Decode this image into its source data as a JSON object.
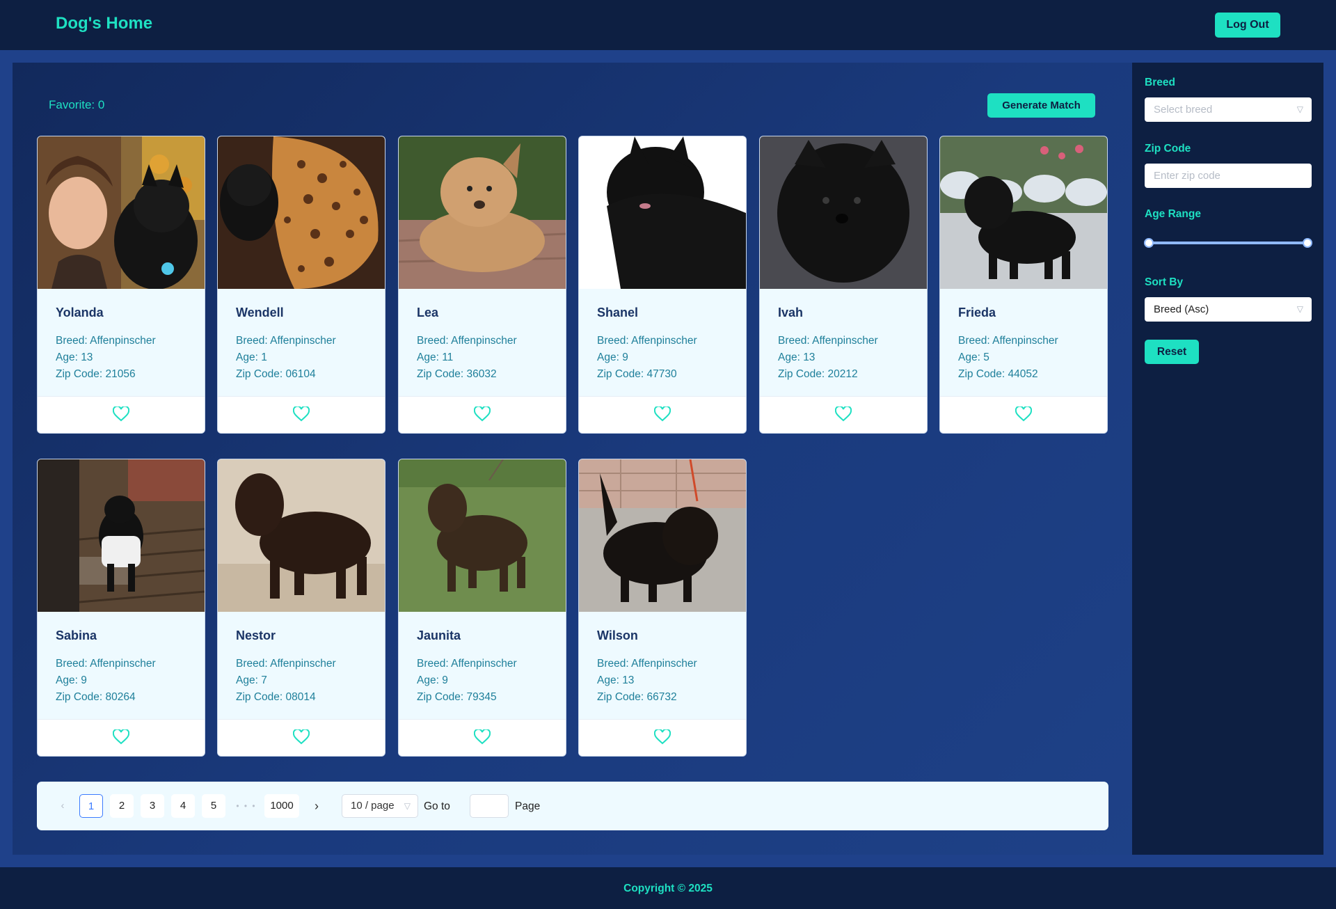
{
  "header": {
    "logo": "Dog's Home",
    "logout_label": "Log Out"
  },
  "toolbar": {
    "favorite_text": "Favorite: 0",
    "generate_label": "Generate Match"
  },
  "dogs": [
    {
      "name": "Yolanda",
      "breed": "Breed: Affenpinscher",
      "age": "Age: 13",
      "zip": "Zip Code: 21056",
      "photo": "dog-with-woman-photo"
    },
    {
      "name": "Wendell",
      "breed": "Breed: Affenpinscher",
      "age": "Age: 1",
      "zip": "Zip Code: 06104",
      "photo": "dog-on-leopard-bed-photo"
    },
    {
      "name": "Lea",
      "breed": "Breed: Affenpinscher",
      "age": "Age: 11",
      "zip": "Zip Code: 36032",
      "photo": "tan-dog-lying-photo"
    },
    {
      "name": "Shanel",
      "breed": "Breed: Affenpinscher",
      "age": "Age: 9",
      "zip": "Zip Code: 47730",
      "photo": "black-dog-white-bg-photo"
    },
    {
      "name": "Ivah",
      "breed": "Breed: Affenpinscher",
      "age": "Age: 13",
      "zip": "Zip Code: 20212",
      "photo": "black-dog-closeup-photo"
    },
    {
      "name": "Frieda",
      "breed": "Breed: Affenpinscher",
      "age": "Age: 5",
      "zip": "Zip Code: 44052",
      "photo": "black-dog-standing-garden-photo"
    },
    {
      "name": "Sabina",
      "breed": "Breed: Affenpinscher",
      "age": "Age: 9",
      "zip": "Zip Code: 80264",
      "photo": "dog-in-shirt-on-deck-photo"
    },
    {
      "name": "Nestor",
      "breed": "Breed: Affenpinscher",
      "age": "Age: 7",
      "zip": "Zip Code: 08014",
      "photo": "brown-dog-standing-photo"
    },
    {
      "name": "Jaunita",
      "breed": "Breed: Affenpinscher",
      "age": "Age: 9",
      "zip": "Zip Code: 79345",
      "photo": "dog-on-grass-photo"
    },
    {
      "name": "Wilson",
      "breed": "Breed: Affenpinscher",
      "age": "Age: 13",
      "zip": "Zip Code: 66732",
      "photo": "dog-on-sidewalk-photo"
    }
  ],
  "pagination": {
    "prev_icon": "‹",
    "pages": [
      "1",
      "2",
      "3",
      "4",
      "5"
    ],
    "ellipsis": "• • •",
    "last_page": "1000",
    "next_icon": "›",
    "current": "1",
    "page_size": "10 / page",
    "goto_label": "Go to",
    "page_label": "Page"
  },
  "sidebar": {
    "breed_label": "Breed",
    "breed_placeholder": "Select breed",
    "zip_label": "Zip Code",
    "zip_placeholder": "Enter zip code",
    "age_label": "Age Range",
    "age_range_fraction": [
      0,
      1
    ],
    "sort_label": "Sort By",
    "sort_value": "Breed (Asc)",
    "reset_label": "Reset"
  },
  "footer": {
    "copyright": "Copyright © 2025"
  },
  "colors": {
    "accent": "#1ee0c2",
    "navy": "#0d1f42",
    "page_bg": "#1f418a",
    "card_text": "#1e7f9a"
  }
}
